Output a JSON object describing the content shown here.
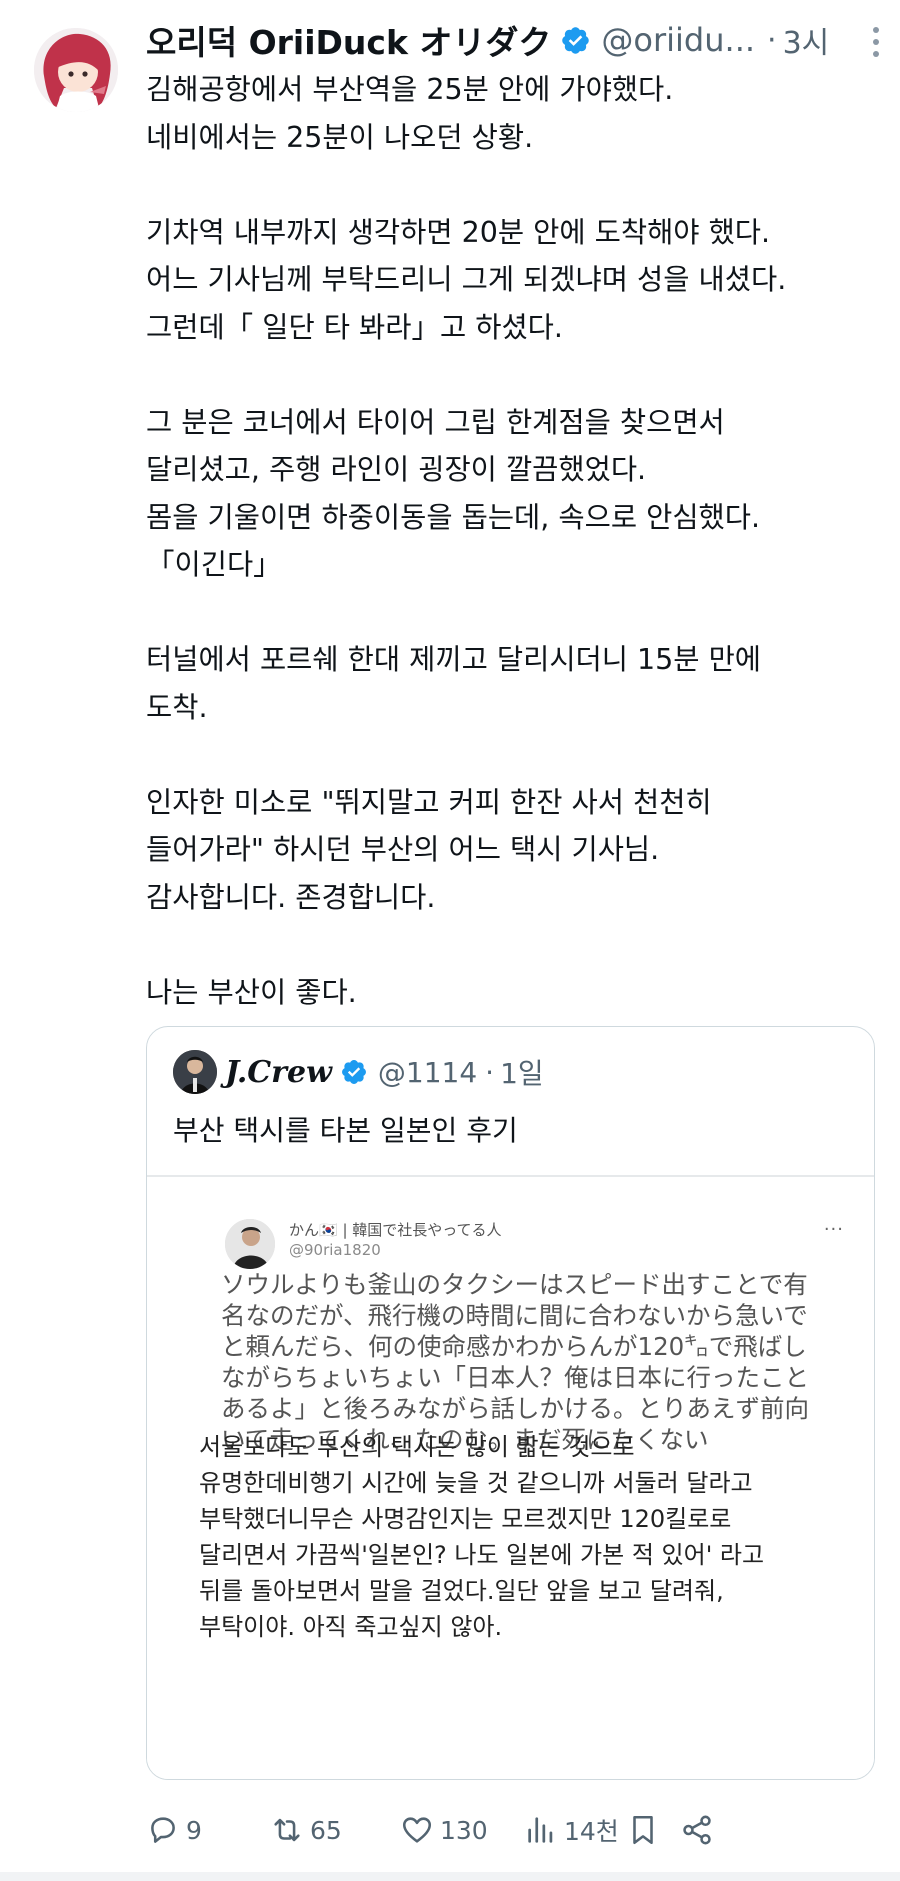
{
  "tweet": {
    "display_name": "오리덕 OriiDuck オリダク",
    "handle": "@oriidu...",
    "dot": "·",
    "time": "3시",
    "lines": [
      "김해공항에서 부산역을 25분 안에 가야했다.",
      "네비에서는 25분이 나오던 상황.",
      "",
      "기차역 내부까지 생각하면 20분 안에 도착해야 했다.",
      "어느 기사님께 부탁드리니 그게 되겠냐며 성을 내셨다.",
      "그런데「 일단 타 봐라」고 하셨다.",
      "",
      "그 분은 코너에서 타이어 그립 한계점을 찾으면서",
      "달리셨고, 주행 라인이 굉장이 깔끔했었다.",
      "몸을 기울이면 하중이동을 돕는데, 속으로 안심했다.",
      "「이긴다」",
      "",
      "터널에서 포르쉐 한대 제끼고 달리시더니 15분 만에",
      "도착.",
      "",
      "인자한 미소로 \"뛰지말고 커피 한잔 사서 천천히",
      "들어가라\" 하시던 부산의 어느 택시 기사님.",
      "감사합니다. 존경합니다.",
      "",
      "나는 부산이 좋다."
    ]
  },
  "quote": {
    "display_name": "J.Crew",
    "handle": "@1114",
    "dot": "·",
    "time": "1일",
    "text": "부산 택시를 타본 일본인 후기",
    "embed": {
      "name": "かん🇰🇷 | 韓国で社長やってる人",
      "handle": "@90ria1820",
      "more": "···",
      "jp_lines": [
        "ソウルよりも釜山のタクシーはスピード出すことで有",
        "名なのだが、飛行機の時間に間に合わないから急いで",
        "と頼んだら、何の使命感かわからんが120㌔で飛ばし",
        "ながらちょいちょい「日本人？俺は日本に行ったこと",
        "あるよ」と後ろみながら話しかける。とりあえず前向",
        "いて走ってくれ、たのむ。まだ死にたくない"
      ],
      "ko_lines": [
        "서울보다도 부산의 택시는 많이 밟는 것으로",
        "유명한데비행기 시간에 늦을 것 같으니까 서둘러 달라고",
        "부탁했더니무슨 사명감인지는 모르겠지만 120킬로로",
        "달리면서 가끔씩'일본인? 나도 일본에 가본 적 있어' 라고",
        "뒤를 돌아보면서 말을 걸었다.일단 앞을 보고 달려줘,",
        "부탁이야. 아직 죽고싶지 않아."
      ]
    }
  },
  "actions": {
    "replies": "9",
    "retweets": "65",
    "likes": "130",
    "views": "14천"
  },
  "colors": {
    "text": "#0f1419",
    "secondary": "#536471",
    "verified_blue": "#1d9bf0",
    "border": "#cfd9de"
  }
}
